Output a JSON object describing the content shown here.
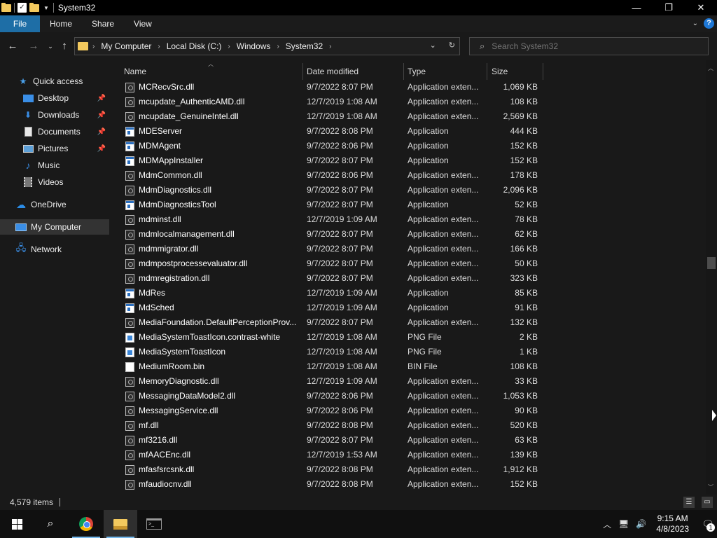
{
  "window": {
    "title": "System32"
  },
  "ribbon": {
    "tabs": [
      "File",
      "Home",
      "Share",
      "View"
    ]
  },
  "nav": {
    "breadcrumbs": [
      "My Computer",
      "Local Disk (C:)",
      "Windows",
      "System32"
    ],
    "search_placeholder": "Search System32"
  },
  "sidebar": {
    "items": [
      {
        "label": "Quick access",
        "icon": "star-icon"
      },
      {
        "label": "Desktop",
        "icon": "desktop-icon",
        "pinned": true
      },
      {
        "label": "Downloads",
        "icon": "download-icon",
        "pinned": true
      },
      {
        "label": "Documents",
        "icon": "document-icon",
        "pinned": true
      },
      {
        "label": "Pictures",
        "icon": "picture-icon",
        "pinned": true
      },
      {
        "label": "Music",
        "icon": "music-icon"
      },
      {
        "label": "Videos",
        "icon": "video-icon"
      },
      {
        "label": "OneDrive",
        "icon": "cloud-icon"
      },
      {
        "label": "My Computer",
        "icon": "computer-icon",
        "selected": true
      },
      {
        "label": "Network",
        "icon": "network-icon"
      }
    ]
  },
  "columns": {
    "name": "Name",
    "date": "Date modified",
    "type": "Type",
    "size": "Size"
  },
  "files": [
    {
      "name": "MCRecvSrc.dll",
      "date": "9/7/2022 8:07 PM",
      "type": "Application exten...",
      "size": "1,069 KB",
      "icon": "dll"
    },
    {
      "name": "mcupdate_AuthenticAMD.dll",
      "date": "12/7/2019 1:08 AM",
      "type": "Application exten...",
      "size": "108 KB",
      "icon": "dll"
    },
    {
      "name": "mcupdate_GenuineIntel.dll",
      "date": "12/7/2019 1:08 AM",
      "type": "Application exten...",
      "size": "2,569 KB",
      "icon": "dll"
    },
    {
      "name": "MDEServer",
      "date": "9/7/2022 8:08 PM",
      "type": "Application",
      "size": "444 KB",
      "icon": "app"
    },
    {
      "name": "MDMAgent",
      "date": "9/7/2022 8:06 PM",
      "type": "Application",
      "size": "152 KB",
      "icon": "app"
    },
    {
      "name": "MDMAppInstaller",
      "date": "9/7/2022 8:07 PM",
      "type": "Application",
      "size": "152 KB",
      "icon": "app"
    },
    {
      "name": "MdmCommon.dll",
      "date": "9/7/2022 8:06 PM",
      "type": "Application exten...",
      "size": "178 KB",
      "icon": "dll"
    },
    {
      "name": "MdmDiagnostics.dll",
      "date": "9/7/2022 8:07 PM",
      "type": "Application exten...",
      "size": "2,096 KB",
      "icon": "dll"
    },
    {
      "name": "MdmDiagnosticsTool",
      "date": "9/7/2022 8:07 PM",
      "type": "Application",
      "size": "52 KB",
      "icon": "app"
    },
    {
      "name": "mdminst.dll",
      "date": "12/7/2019 1:09 AM",
      "type": "Application exten...",
      "size": "78 KB",
      "icon": "dll"
    },
    {
      "name": "mdmlocalmanagement.dll",
      "date": "9/7/2022 8:07 PM",
      "type": "Application exten...",
      "size": "62 KB",
      "icon": "dll"
    },
    {
      "name": "mdmmigrator.dll",
      "date": "9/7/2022 8:07 PM",
      "type": "Application exten...",
      "size": "166 KB",
      "icon": "dll"
    },
    {
      "name": "mdmpostprocessevaluator.dll",
      "date": "9/7/2022 8:07 PM",
      "type": "Application exten...",
      "size": "50 KB",
      "icon": "dll"
    },
    {
      "name": "mdmregistration.dll",
      "date": "9/7/2022 8:07 PM",
      "type": "Application exten...",
      "size": "323 KB",
      "icon": "dll"
    },
    {
      "name": "MdRes",
      "date": "12/7/2019 1:09 AM",
      "type": "Application",
      "size": "85 KB",
      "icon": "app"
    },
    {
      "name": "MdSched",
      "date": "12/7/2019 1:09 AM",
      "type": "Application",
      "size": "91 KB",
      "icon": "app"
    },
    {
      "name": "MediaFoundation.DefaultPerceptionProv...",
      "date": "9/7/2022 8:07 PM",
      "type": "Application exten...",
      "size": "132 KB",
      "icon": "dll"
    },
    {
      "name": "MediaSystemToastIcon.contrast-white",
      "date": "12/7/2019 1:08 AM",
      "type": "PNG File",
      "size": "2 KB",
      "icon": "png"
    },
    {
      "name": "MediaSystemToastIcon",
      "date": "12/7/2019 1:08 AM",
      "type": "PNG File",
      "size": "1 KB",
      "icon": "png"
    },
    {
      "name": "MediumRoom.bin",
      "date": "12/7/2019 1:08 AM",
      "type": "BIN File",
      "size": "108 KB",
      "icon": "bin"
    },
    {
      "name": "MemoryDiagnostic.dll",
      "date": "12/7/2019 1:09 AM",
      "type": "Application exten...",
      "size": "33 KB",
      "icon": "dll"
    },
    {
      "name": "MessagingDataModel2.dll",
      "date": "9/7/2022 8:06 PM",
      "type": "Application exten...",
      "size": "1,053 KB",
      "icon": "dll"
    },
    {
      "name": "MessagingService.dll",
      "date": "9/7/2022 8:06 PM",
      "type": "Application exten...",
      "size": "90 KB",
      "icon": "dll"
    },
    {
      "name": "mf.dll",
      "date": "9/7/2022 8:08 PM",
      "type": "Application exten...",
      "size": "520 KB",
      "icon": "dll"
    },
    {
      "name": "mf3216.dll",
      "date": "9/7/2022 8:07 PM",
      "type": "Application exten...",
      "size": "63 KB",
      "icon": "dll"
    },
    {
      "name": "mfAACEnc.dll",
      "date": "12/7/2019 1:53 AM",
      "type": "Application exten...",
      "size": "139 KB",
      "icon": "dll"
    },
    {
      "name": "mfasfsrcsnk.dll",
      "date": "9/7/2022 8:08 PM",
      "type": "Application exten...",
      "size": "1,912 KB",
      "icon": "dll"
    },
    {
      "name": "mfaudiocnv.dll",
      "date": "9/7/2022 8:08 PM",
      "type": "Application exten...",
      "size": "152 KB",
      "icon": "dll"
    }
  ],
  "status": {
    "item_count": "4,579 items"
  },
  "taskbar": {
    "time": "9:15 AM",
    "date": "4/8/2023",
    "notification_count": "1"
  },
  "colors": {
    "accent": "#1e6ea6",
    "background": "#191919",
    "selection": "#333333"
  }
}
